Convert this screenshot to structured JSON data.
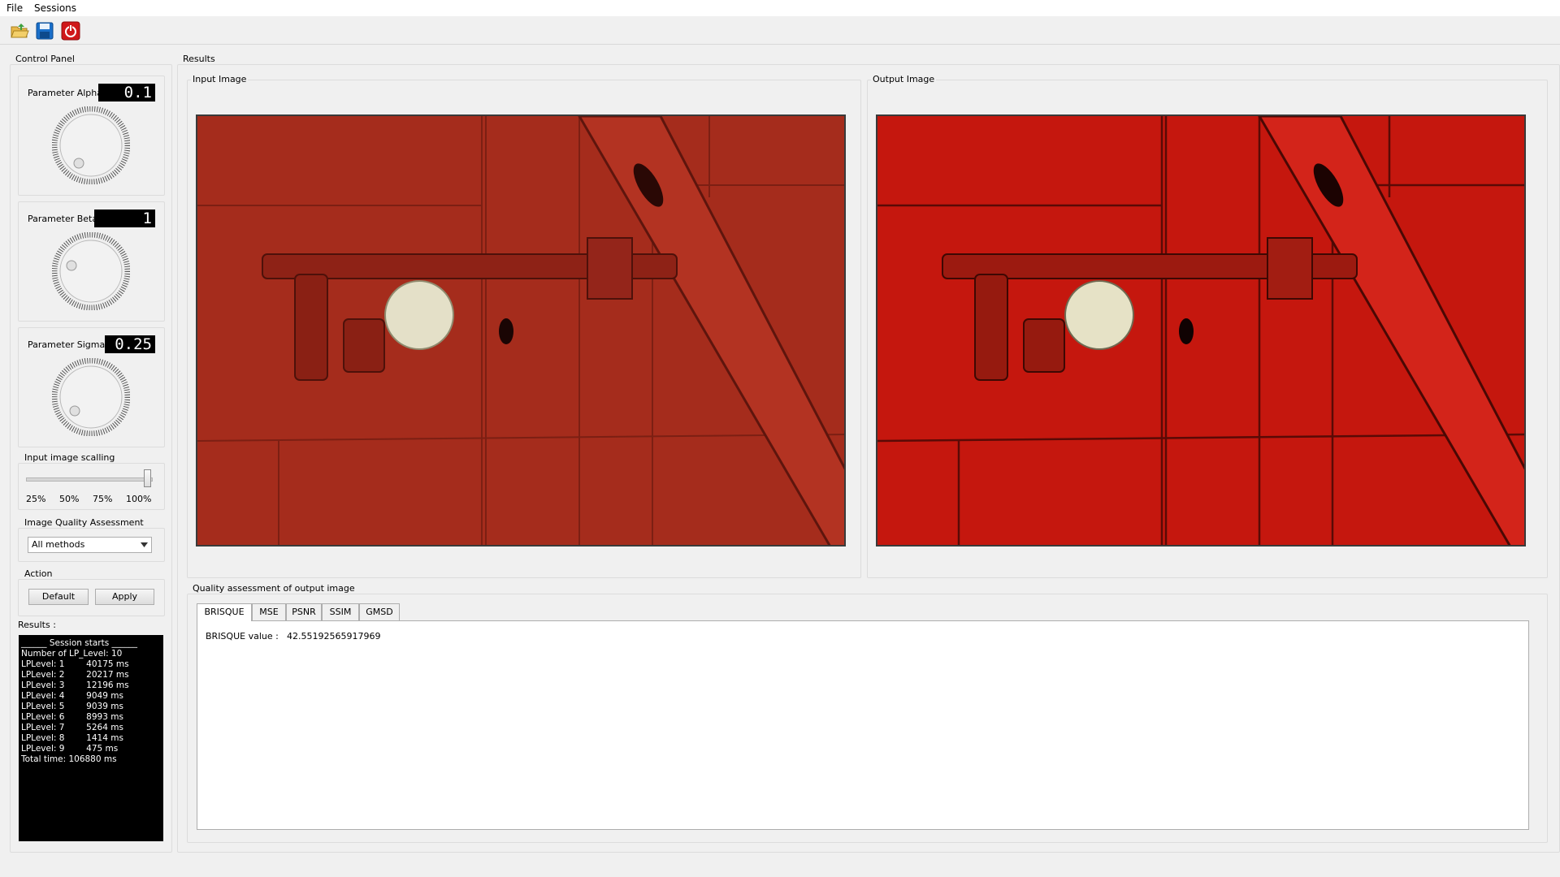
{
  "menu": {
    "file": "File",
    "sessions": "Sessions"
  },
  "toolbar": {
    "open_icon": "folder-open-icon",
    "save_icon": "floppy-save-icon",
    "power_icon": "power-icon"
  },
  "control_panel": {
    "title": "Control Panel",
    "alpha": {
      "label": "Parameter Alpha",
      "value": "0.1"
    },
    "beta": {
      "label": "Parameter Beta",
      "value": "1"
    },
    "sigma": {
      "label": "Parameter SigmaR",
      "value": "0.25"
    },
    "scaling": {
      "title": "Input image scalling",
      "ticks": [
        "25%",
        "50%",
        "75%",
        "100%"
      ],
      "value_percent": 100
    },
    "iqa": {
      "title": "Image Quality Assessment",
      "selected": "All methods"
    },
    "action": {
      "title": "Action",
      "default_label": "Default",
      "apply_label": "Apply"
    },
    "results_label": "Results :"
  },
  "console_lines": [
    "______ Session starts ______",
    "Number of LP_Level: 10",
    "LPLevel: 1        40175 ms",
    "LPLevel: 2        20217 ms",
    "LPLevel: 3        12196 ms",
    "LPLevel: 4        9049 ms",
    "LPLevel: 5        9039 ms",
    "LPLevel: 6        8993 ms",
    "LPLevel: 7        5264 ms",
    "LPLevel: 8        1414 ms",
    "LPLevel: 9        475 ms",
    "Total time: 106880 ms"
  ],
  "results": {
    "title": "Results",
    "input_title": "Input Image",
    "output_title": "Output Image",
    "quality_title": "Quality assessment of output image",
    "tabs": [
      "BRISQUE",
      "MSE",
      "PSNR",
      "SSIM",
      "GMSD"
    ],
    "active_tab": "BRISQUE",
    "brisque_label": "BRISQUE value :",
    "brisque_value": "42.55192565917969"
  },
  "colors": {
    "lcd_bg": "#000000",
    "door_red": "#a82a1a",
    "door_red_enhanced": "#c8180f"
  }
}
